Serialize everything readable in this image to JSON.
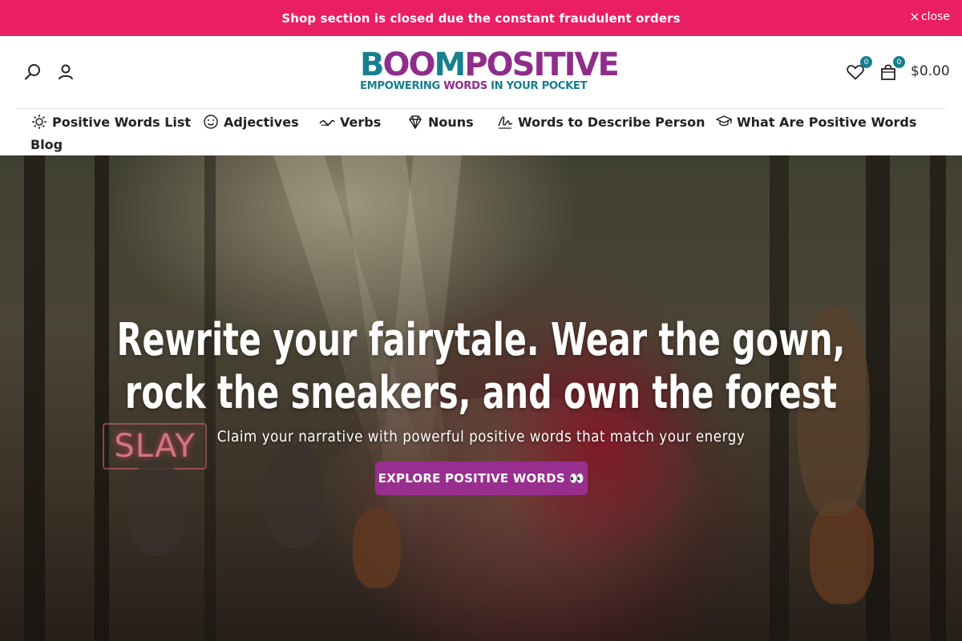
{
  "announcement": {
    "text": "Shop section is closed due the constant fraudulent orders",
    "close_label": "close"
  },
  "header": {
    "logo": {
      "boom_part1": "B",
      "boom_oo": "OO",
      "boom_part2": "M",
      "positive": "POSITIVE",
      "tagline_part1": "EMPOWERING ",
      "tagline_part2": "WORDS",
      "tagline_part3": " IN YOUR POCKET"
    },
    "icons": {
      "search": "search-icon",
      "account": "user-icon",
      "wishlist": "heart-icon",
      "cart": "shopping-bag-icon"
    },
    "wishlist_count": "0",
    "cart_count": "0",
    "cart_total": "$0.00"
  },
  "nav": {
    "items": [
      {
        "label": "Positive Words List",
        "icon": "sun-icon"
      },
      {
        "label": "Adjectives",
        "icon": "smile-icon"
      },
      {
        "label": "Verbs",
        "icon": "wave-icon"
      },
      {
        "label": "Nouns",
        "icon": "diamond-icon"
      },
      {
        "label": "Words to Describe Person",
        "icon": "sign-icon"
      },
      {
        "label": "What Are Positive Words",
        "icon": "graduation-cap-icon"
      },
      {
        "label": "Blog",
        "icon": ""
      }
    ]
  },
  "hero": {
    "title_line1": "Rewrite your fairytale. Wear the gown,",
    "title_line2": "rock the sneakers, and own the forest",
    "subtitle": "Claim your narrative with powerful positive words that match your energy",
    "button_label": "EXPLORE POSITIVE WORDS 👀",
    "neon_sign": "SLAY"
  },
  "colors": {
    "announcement_bg": "#e91e63",
    "brand_teal": "#16808f",
    "brand_purple": "#8e2e8a",
    "button_bg": "#982f8f"
  }
}
